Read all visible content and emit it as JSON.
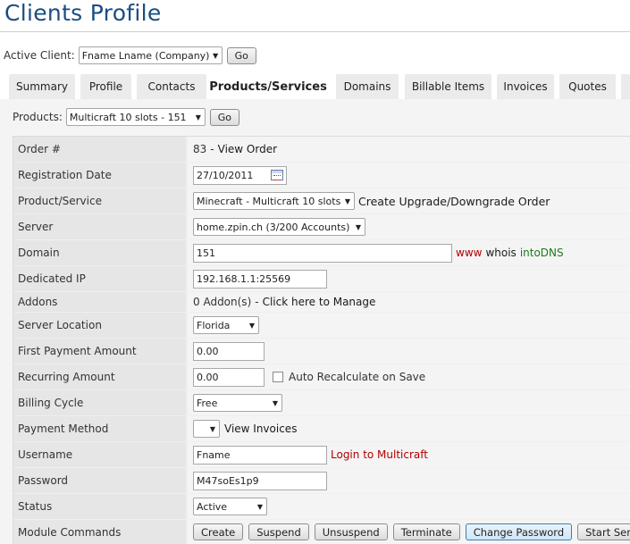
{
  "page": {
    "title": "Clients Profile"
  },
  "active_client": {
    "label": "Active Client:",
    "selected": "Fname Lname (Company)",
    "go_label": "Go"
  },
  "tabs": [
    {
      "label": "Summary"
    },
    {
      "label": "Profile"
    },
    {
      "label": "Contacts"
    },
    {
      "label": "Products/Services"
    },
    {
      "label": "Domains"
    },
    {
      "label": "Billable Items"
    },
    {
      "label": "Invoices"
    },
    {
      "label": "Quotes"
    }
  ],
  "products": {
    "label": "Products:",
    "selected": "Multicraft 10 slots - 151",
    "go_label": "Go"
  },
  "form": {
    "order": {
      "label": "Order #",
      "number": "83",
      "sep": "-",
      "link": "View Order"
    },
    "registration_date": {
      "label": "Registration Date",
      "value": "27/10/2011"
    },
    "product_service": {
      "label": "Product/Service",
      "selected": "Minecraft - Multicraft 10 slots",
      "link": "Create Upgrade/Downgrade Order"
    },
    "server": {
      "label": "Server",
      "selected": "home.zpin.ch (3/200 Accounts)"
    },
    "domain": {
      "label": "Domain",
      "value": "151",
      "link_www": "www",
      "link_whois": "whois",
      "link_intodns": "intoDNS"
    },
    "dedicated_ip": {
      "label": "Dedicated IP",
      "value": "192.168.1.1:25569"
    },
    "addons": {
      "label": "Addons",
      "text": "0 Addon(s)",
      "sep": "-",
      "link": "Click here to Manage"
    },
    "server_location": {
      "label": "Server Location",
      "selected": "Florida"
    },
    "first_payment": {
      "label": "First Payment Amount",
      "value": "0.00"
    },
    "recurring": {
      "label": "Recurring Amount",
      "value": "0.00",
      "checkbox_label": "Auto Recalculate on Save"
    },
    "billing_cycle": {
      "label": "Billing Cycle",
      "selected": "Free"
    },
    "payment_method": {
      "label": "Payment Method",
      "selected": "",
      "link": "View Invoices"
    },
    "username": {
      "label": "Username",
      "value": "Fname",
      "link": "Login to Multicraft"
    },
    "password": {
      "label": "Password",
      "value": "M47soEs1p9"
    },
    "status": {
      "label": "Status",
      "selected": "Active"
    },
    "module_commands": {
      "label": "Module Commands",
      "buttons": [
        {
          "label": "Create"
        },
        {
          "label": "Suspend"
        },
        {
          "label": "Unsuspend"
        },
        {
          "label": "Terminate"
        },
        {
          "label": "Change Password"
        },
        {
          "label": "Start Server"
        }
      ]
    }
  },
  "colors": {
    "title": "#1a4d80",
    "link_red": "#b00000",
    "link_green": "#1f7a1f",
    "highlight_border": "#3c7fb1"
  }
}
